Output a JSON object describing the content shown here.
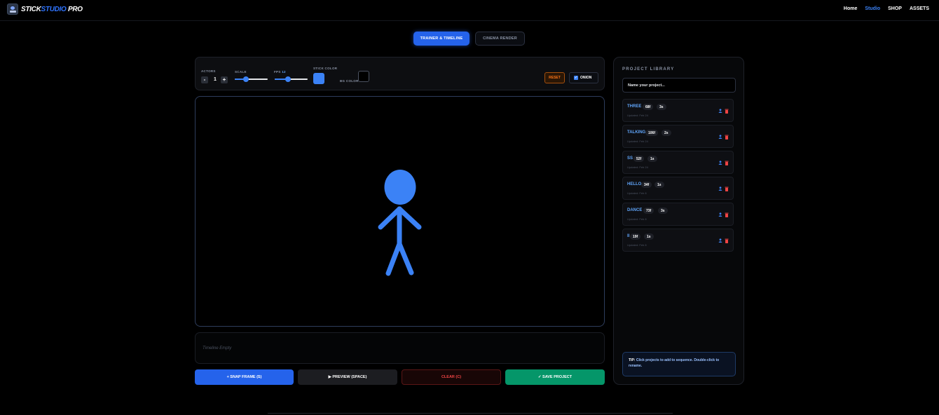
{
  "app": {
    "logo_text_a": "STICK",
    "logo_text_b": "STUDIO",
    "logo_text_c": " PRO"
  },
  "nav": {
    "home": "Home",
    "studio": "Studio",
    "shop": "SHOP",
    "assets": "ASSETS",
    "active": "Studio"
  },
  "modes": {
    "trainer": "TRAINER & TIMELINE",
    "cinema": "CINEMA RENDER",
    "active": "trainer"
  },
  "controls": {
    "actors_label": "ACTORS",
    "actors_value": "1",
    "minus": "-",
    "plus": "+",
    "scale_label": "SCALE",
    "scale_level": 0.35,
    "fps_label": "FPS",
    "fps_value": "12",
    "fps_level": 0.4,
    "stick_color_label": "STICK COLOR",
    "stick_color": "#3b82f6",
    "bg_color_label": "BG COLOR",
    "bg_color": "#000000",
    "reset": "RESET",
    "onion": "ONION",
    "onion_checked": true
  },
  "canvas": {
    "figure_color": "#3b82f6"
  },
  "timeline": {
    "empty_text": "Timeline Empty"
  },
  "actions": {
    "snap": "+ SNAP FRAME (S)",
    "preview": "▶ PREVIEW (SPACE)",
    "clear": "CLEAR (C)",
    "save": "✓ SAVE PROJECT"
  },
  "library": {
    "title": "PROJECT LIBRARY",
    "input_placeholder": "Name your project...",
    "projects": [
      {
        "name": "THREE",
        "frames": "68f",
        "duration": "3s",
        "updated": "Updated: Feb 24"
      },
      {
        "name": "TALKING",
        "frames": "106f",
        "duration": "2s",
        "updated": "Updated: Feb 24"
      },
      {
        "name": "SS",
        "frames": "52f",
        "duration": "1s",
        "updated": "Updated: Feb 24"
      },
      {
        "name": "HELLO",
        "frames": "34f",
        "duration": "1s",
        "updated": "Updated: Feb 8"
      },
      {
        "name": "DANCE",
        "frames": "73f",
        "duration": "3s",
        "updated": "Updated: Feb 8"
      },
      {
        "name": "II",
        "frames": "19f",
        "duration": "1s",
        "updated": "Updated: Feb 8"
      }
    ],
    "tip_label": "TIP:",
    "tip_text": "Click projects to add to sequence. Double-click to rename."
  },
  "colors": {
    "accent": "#2563eb",
    "save": "#059669",
    "danger": "#ef4444",
    "warning": "#f97316"
  }
}
